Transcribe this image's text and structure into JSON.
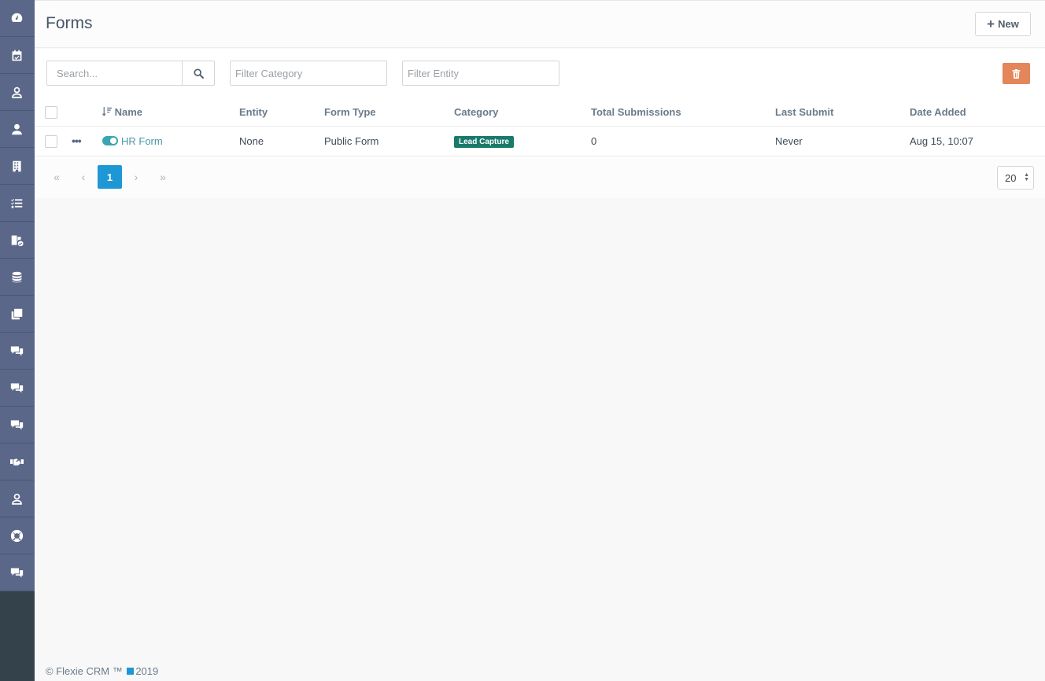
{
  "sidebar": {
    "items": [
      {
        "icon": "dashboard-icon"
      },
      {
        "icon": "calendar-check-icon"
      },
      {
        "icon": "user-outline-icon"
      },
      {
        "icon": "user-icon"
      },
      {
        "icon": "building-icon"
      },
      {
        "icon": "task-list-icon"
      },
      {
        "icon": "workflow-icon"
      },
      {
        "icon": "database-icon"
      },
      {
        "icon": "copy-icon"
      },
      {
        "icon": "chat-icon"
      },
      {
        "icon": "chat-icon"
      },
      {
        "icon": "chat-icon"
      },
      {
        "icon": "handshake-icon"
      },
      {
        "icon": "user-outline-icon"
      },
      {
        "icon": "life-ring-icon"
      },
      {
        "icon": "chat-icon"
      }
    ]
  },
  "header": {
    "title": "Forms",
    "new_label": "New"
  },
  "filters": {
    "search_placeholder": "Search...",
    "category_placeholder": "Filter Category",
    "entity_placeholder": "Filter Entity"
  },
  "table": {
    "columns": [
      "Name",
      "Entity",
      "Form Type",
      "Category",
      "Total Submissions",
      "Last Submit",
      "Date Added"
    ],
    "rows": [
      {
        "name": "HR Form",
        "entity": "None",
        "form_type": "Public Form",
        "category": "Lead Capture",
        "total_submissions": "0",
        "last_submit": "Never",
        "date_added": "Aug 15, 10:07",
        "published": true
      }
    ]
  },
  "pagination": {
    "current_page": "1",
    "per_page": "20"
  },
  "footer": {
    "text": "© Flexie CRM ™",
    "year": "2019"
  },
  "colors": {
    "sidebar": "#5b6788",
    "accent": "#1d98d4",
    "delete": "#e3865a",
    "badge": "#197a6a",
    "toggle": "#3aa6b0"
  }
}
